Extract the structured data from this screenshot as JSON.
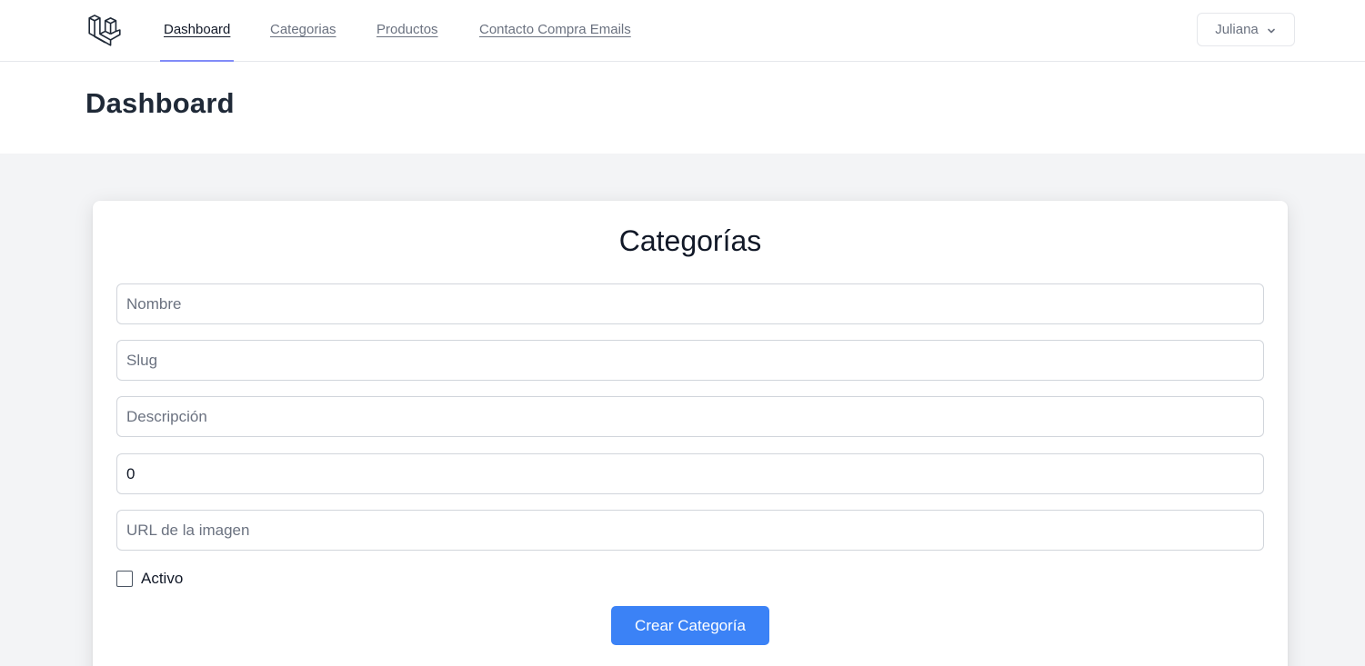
{
  "nav": {
    "logo_icon": "laravel-logo-icon",
    "links": [
      {
        "label": "Dashboard",
        "active": true
      },
      {
        "label": "Categorias",
        "active": false
      },
      {
        "label": "Productos",
        "active": false
      },
      {
        "label": "Contacto Compra Emails",
        "active": false
      }
    ],
    "user": {
      "name": "Juliana",
      "icon": "chevron-down-icon"
    }
  },
  "header": {
    "title": "Dashboard"
  },
  "form": {
    "title": "Categorías",
    "fields": {
      "nombre": {
        "placeholder": "Nombre",
        "value": ""
      },
      "slug": {
        "placeholder": "Slug",
        "value": ""
      },
      "descripcion": {
        "placeholder": "Descripción",
        "value": ""
      },
      "orden": {
        "placeholder": "",
        "value": "0"
      },
      "imagen": {
        "placeholder": "URL de la imagen",
        "value": ""
      }
    },
    "activo": {
      "label": "Activo",
      "checked": false
    },
    "submit_label": "Crear Categoría"
  },
  "colors": {
    "accent": "#3b82f6",
    "nav_active_indicator": "#818cf8",
    "page_background": "#f3f4f6"
  }
}
